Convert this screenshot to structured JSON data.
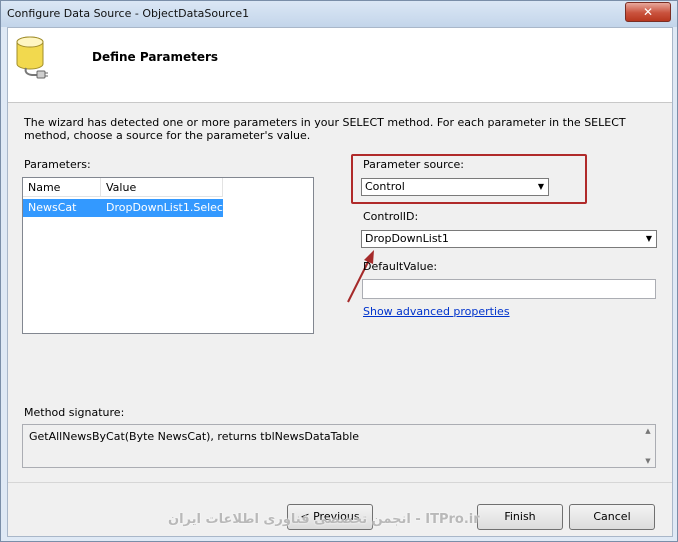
{
  "window": {
    "title": "Configure Data Source - ObjectDataSource1",
    "close_glyph": "✕"
  },
  "header": {
    "icon": "database-plug-icon",
    "title": "Define Parameters"
  },
  "description": "The wizard has detected one or more parameters in your SELECT method. For each parameter in the SELECT method, choose a source for the parameter's value.",
  "parameters": {
    "label": "Parameters:",
    "columns": [
      "Name",
      "Value"
    ],
    "rows": [
      {
        "name": "NewsCat",
        "value": "DropDownList1.Selec..."
      }
    ]
  },
  "parameter_source": {
    "label": "Parameter source:",
    "value": "Control"
  },
  "control_id": {
    "label": "ControlID:",
    "value": "DropDownList1"
  },
  "default_value": {
    "label": "DefaultValue:",
    "value": ""
  },
  "advanced_link": "Show advanced properties",
  "method_signature": {
    "label": "Method signature:",
    "value": "GetAllNewsByCat(Byte NewsCat), returns tblNewsDataTable"
  },
  "buttons": {
    "previous": "< Previous",
    "finish": "Finish",
    "cancel": "Cancel"
  },
  "watermark": "انجمن تخصصی فناوری اطلاعات ایران - ITPro.ir",
  "colors": {
    "selection": "#3399ff",
    "highlight_box": "#b02a2a",
    "link": "#0033cc"
  }
}
